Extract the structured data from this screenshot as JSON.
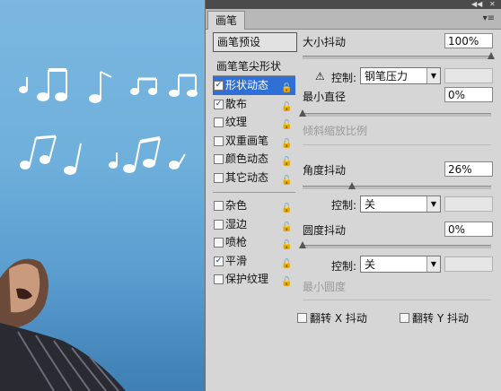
{
  "panel": {
    "tab_label": "画笔",
    "collapse_glyph": "◀◀",
    "close_glyph": "✕",
    "menu_glyph": "▾≡"
  },
  "sidebar": {
    "preset_button": "画笔预设",
    "tip_shape": "画笔笔尖形状",
    "items": [
      {
        "label": "形状动态",
        "checked": true,
        "selected": true
      },
      {
        "label": "散布",
        "checked": true,
        "selected": false
      },
      {
        "label": "纹理",
        "checked": false,
        "selected": false
      },
      {
        "label": "双重画笔",
        "checked": false,
        "selected": false
      },
      {
        "label": "颜色动态",
        "checked": false,
        "selected": false
      },
      {
        "label": "其它动态",
        "checked": false,
        "selected": false
      },
      {
        "label": "杂色",
        "checked": false,
        "selected": false
      },
      {
        "label": "湿边",
        "checked": false,
        "selected": false
      },
      {
        "label": "喷枪",
        "checked": false,
        "selected": false
      },
      {
        "label": "平滑",
        "checked": true,
        "selected": false
      },
      {
        "label": "保护纹理",
        "checked": false,
        "selected": false
      }
    ],
    "lock_glyph": "🔓",
    "check_glyph": "✓"
  },
  "controls": {
    "size_jitter": {
      "label": "大小抖动",
      "value": "100%",
      "slider": 1.0
    },
    "size_control": {
      "warn_icon": "⚠",
      "label": "控制:",
      "value": "钢笔压力"
    },
    "min_diameter": {
      "label": "最小直径",
      "value": "0%",
      "slider": 0.0
    },
    "tilt_scale": {
      "label": "倾斜缩放比例"
    },
    "angle_jitter": {
      "label": "角度抖动",
      "value": "26%",
      "slider": 0.26
    },
    "angle_control": {
      "label": "控制:",
      "value": "关"
    },
    "roundness_jitter": {
      "label": "圆度抖动",
      "value": "0%",
      "slider": 0.0
    },
    "roundness_control": {
      "label": "控制:",
      "value": "关"
    },
    "min_roundness": {
      "label": "最小圆度"
    },
    "flip_x": {
      "label": "翻转 X 抖动"
    },
    "flip_y": {
      "label": "翻转 Y 抖动"
    }
  },
  "colors": {
    "selected": "#2f6fd6",
    "panel_bg": "#d6d6d6"
  }
}
